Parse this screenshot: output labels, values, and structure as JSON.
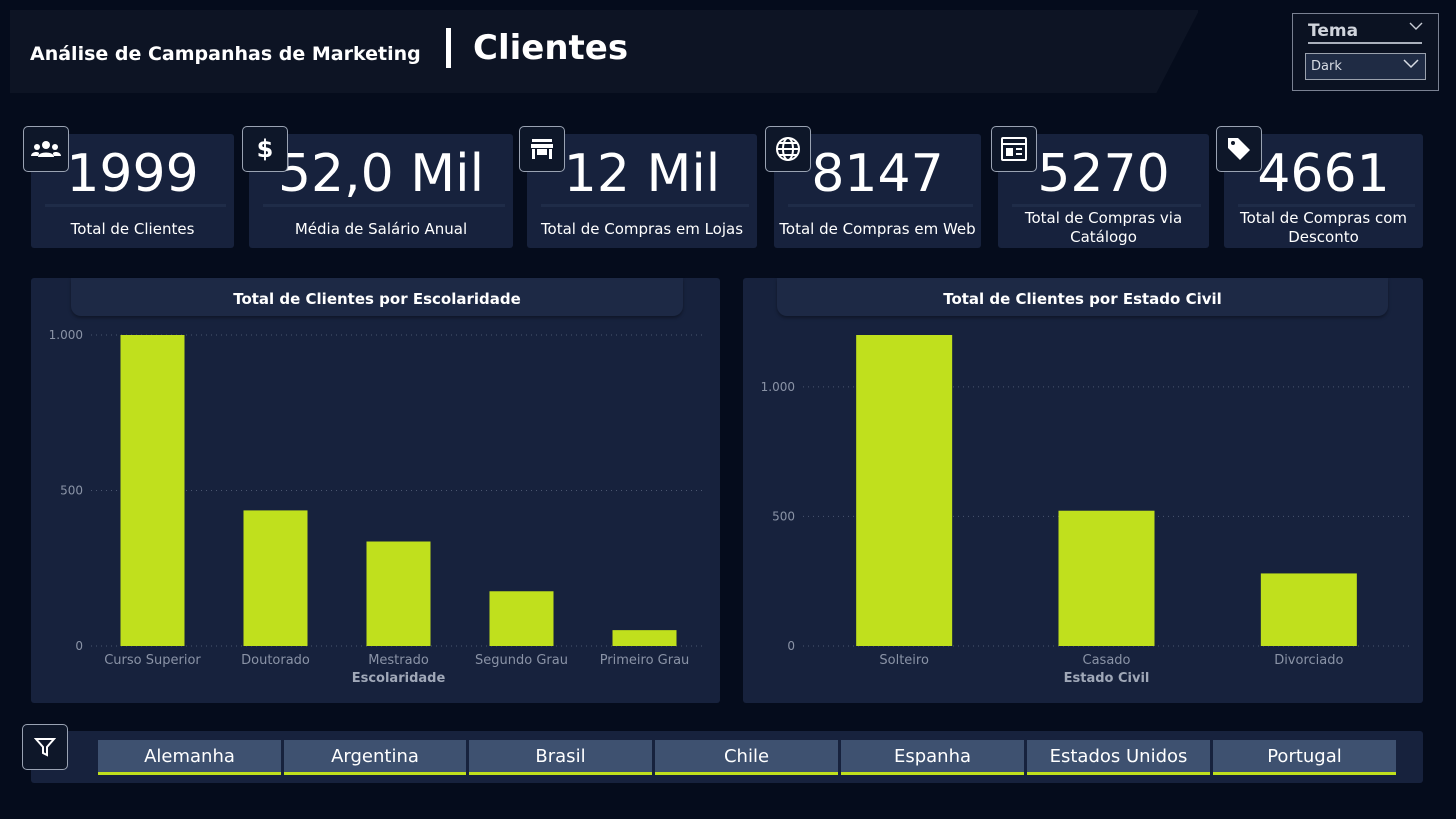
{
  "header": {
    "subtitle": "Análise de Campanhas de Marketing",
    "title": "Clientes"
  },
  "theme": {
    "label": "Tema",
    "selected": "Dark"
  },
  "kpis": [
    {
      "value": "1999",
      "label": "Total de Clientes",
      "icon": "users-icon"
    },
    {
      "value": "52,0 Mil",
      "label": "Média de Salário Anual",
      "icon": "dollar-icon"
    },
    {
      "value": "12 Mil",
      "label": "Total de Compras em Lojas",
      "icon": "store-icon"
    },
    {
      "value": "8147",
      "label": "Total de Compras em Web",
      "icon": "globe-icon"
    },
    {
      "value": "5270",
      "label": "Total de Compras via Catálogo",
      "icon": "catalog-icon"
    },
    {
      "value": "4661",
      "label": "Total de Compras com Desconto",
      "icon": "tag-icon"
    }
  ],
  "colors": {
    "accent": "#c0e01d",
    "background": "#050c1c",
    "card": "#17223d"
  },
  "chart_data": [
    {
      "type": "bar",
      "title": "Total de Clientes por Escolaridade",
      "xlabel": "Escolaridade",
      "ylabel": "",
      "categories": [
        "Curso Superior",
        "Doutorado",
        "Mestrado",
        "Segundo Grau",
        "Primeiro Grau"
      ],
      "values": [
        1000,
        436,
        336,
        176,
        51
      ],
      "ylim": [
        0,
        1000
      ],
      "yticks": [
        0,
        500,
        1000
      ],
      "ytick_labels": [
        "0",
        "500",
        "1.000"
      ],
      "grid": true,
      "color": "#c0e01d"
    },
    {
      "type": "bar",
      "title": "Total de Clientes por Estado Civil",
      "xlabel": "Estado Civil",
      "ylabel": "",
      "categories": [
        "Solteiro",
        "Casado",
        "Divorciado"
      ],
      "values": [
        1200,
        522,
        280
      ],
      "ylim": [
        0,
        1200
      ],
      "yticks": [
        0,
        500,
        1000
      ],
      "ytick_labels": [
        "0",
        "500",
        "1.000"
      ],
      "grid": true,
      "color": "#c0e01d"
    }
  ],
  "filter": {
    "icon": "filter-icon",
    "countries": [
      "Alemanha",
      "Argentina",
      "Brasil",
      "Chile",
      "Espanha",
      "Estados Unidos",
      "Portugal"
    ]
  }
}
